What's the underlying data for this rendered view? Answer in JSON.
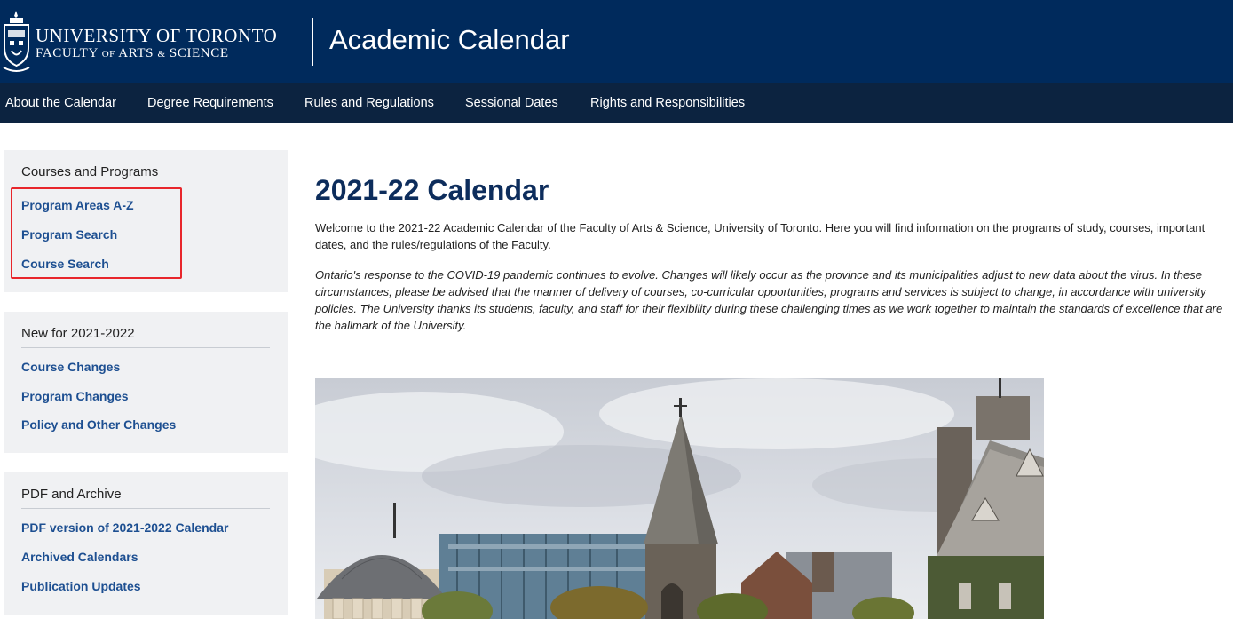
{
  "header": {
    "university_name": "UNIVERSITY OF TORONTO",
    "faculty_prefix": "FACULTY",
    "faculty_of": "OF",
    "faculty_arts": "ARTS",
    "faculty_amp": "&",
    "faculty_science": "SCIENCE",
    "site_title": "Academic Calendar"
  },
  "nav": {
    "items": [
      {
        "label": "About the Calendar"
      },
      {
        "label": "Degree Requirements"
      },
      {
        "label": "Rules and Regulations"
      },
      {
        "label": "Sessional Dates"
      },
      {
        "label": "Rights and Responsibilities"
      }
    ]
  },
  "sidebar": {
    "sections": [
      {
        "title": "Courses and Programs",
        "links": [
          {
            "label": "Program Areas A-Z"
          },
          {
            "label": "Program Search"
          },
          {
            "label": "Course Search"
          }
        ]
      },
      {
        "title": "New for 2021-2022",
        "links": [
          {
            "label": "Course Changes"
          },
          {
            "label": "Program Changes"
          },
          {
            "label": "Policy and Other Changes"
          }
        ]
      },
      {
        "title": "PDF and Archive",
        "links": [
          {
            "label": "PDF version of 2021-2022 Calendar"
          },
          {
            "label": "Archived Calendars"
          },
          {
            "label": "Publication Updates"
          }
        ]
      }
    ]
  },
  "main": {
    "title": "2021-22 Calendar",
    "intro": "Welcome to the 2021-22 Academic Calendar of the Faculty of Arts & Science, University of Toronto. Here you will find information on the programs of study, courses, important dates, and the rules/regulations of the Faculty.",
    "covid_notice": "Ontario's response to the COVID-19 pandemic continues to evolve. Changes will likely occur as the province and its municipalities adjust to new data about the virus. In these circumstances, please be advised that the manner of delivery of courses, co-curricular opportunities, programs and services is subject to change, in accordance with university policies. The University thanks its students, faculty, and staff for their flexibility during these challenging times as we work together to maintain the standards of excellence that are the hallmark of the University."
  },
  "colors": {
    "header_bg": "#002a5c",
    "nav_bg": "#0c2340",
    "link": "#1d4f91",
    "title": "#0d2d5c",
    "highlight": "#e8262b"
  }
}
